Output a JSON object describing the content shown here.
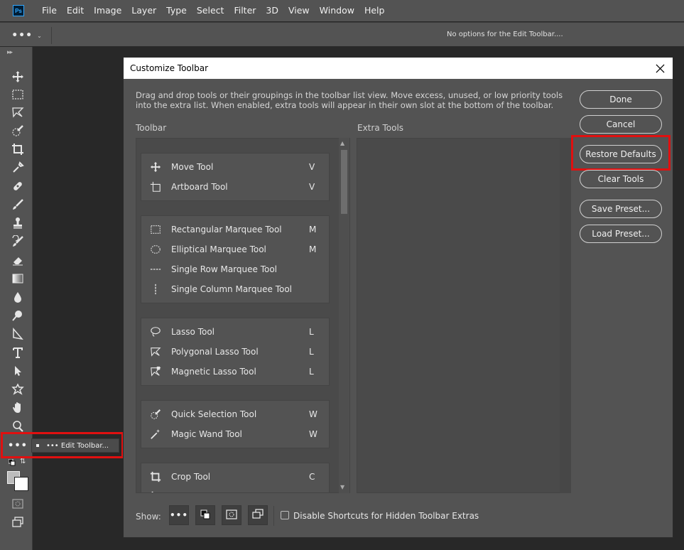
{
  "app": {
    "logo": "Ps"
  },
  "menubar": {
    "items": [
      "File",
      "Edit",
      "Image",
      "Layer",
      "Type",
      "Select",
      "Filter",
      "3D",
      "View",
      "Window",
      "Help"
    ]
  },
  "optionsbar": {
    "dots": "•••",
    "message": "No options for the Edit Toolbar...."
  },
  "toolbar": {
    "icons": [
      "move-icon",
      "rect-marquee-icon",
      "lasso-icon",
      "quick-select-icon",
      "crop-icon",
      "eyedropper-icon",
      "healing-icon",
      "brush-icon",
      "stamp-icon",
      "history-brush-icon",
      "eraser-icon",
      "gradient-icon",
      "blur-icon",
      "dodge-icon",
      "pen-icon",
      "type-icon",
      "path-select-icon",
      "shape-icon",
      "hand-icon",
      "zoom-icon"
    ],
    "more_dots": "•••",
    "edit_toolbar_label": "••• Edit Toolbar..."
  },
  "dialog": {
    "title": "Customize Toolbar",
    "description": "Drag and drop tools or their groupings in the toolbar list view. Move excess, unused, or low priority tools into the extra list. When enabled, extra tools will appear in their own slot at the bottom of the toolbar.",
    "toolbar_label": "Toolbar",
    "extra_label": "Extra Tools",
    "groups": [
      {
        "tools": [
          {
            "icon": "move-icon",
            "name": "Move Tool",
            "key": "V"
          },
          {
            "icon": "artboard-icon",
            "name": "Artboard Tool",
            "key": "V"
          }
        ]
      },
      {
        "tools": [
          {
            "icon": "rect-marquee-icon",
            "name": "Rectangular Marquee Tool",
            "key": "M"
          },
          {
            "icon": "ellipse-marquee-icon",
            "name": "Elliptical Marquee Tool",
            "key": "M"
          },
          {
            "icon": "row-marquee-icon",
            "name": "Single Row Marquee Tool",
            "key": ""
          },
          {
            "icon": "column-marquee-icon",
            "name": "Single Column Marquee Tool",
            "key": ""
          }
        ]
      },
      {
        "tools": [
          {
            "icon": "lasso-icon",
            "name": "Lasso Tool",
            "key": "L"
          },
          {
            "icon": "polygonal-lasso-icon",
            "name": "Polygonal Lasso Tool",
            "key": "L"
          },
          {
            "icon": "magnetic-lasso-icon",
            "name": "Magnetic Lasso Tool",
            "key": "L"
          }
        ]
      },
      {
        "tools": [
          {
            "icon": "quick-select-icon",
            "name": "Quick Selection Tool",
            "key": "W"
          },
          {
            "icon": "magic-wand-icon",
            "name": "Magic Wand Tool",
            "key": "W"
          }
        ]
      },
      {
        "tools": [
          {
            "icon": "crop-icon",
            "name": "Crop Tool",
            "key": "C"
          }
        ]
      }
    ],
    "buttons": {
      "done": "Done",
      "cancel": "Cancel",
      "restore": "Restore Defaults",
      "clear": "Clear Tools",
      "save": "Save Preset...",
      "load": "Load Preset..."
    },
    "show_label": "Show:",
    "show_options": [
      "dots-icon",
      "fg-bg-icon",
      "quick-mask-icon",
      "screen-mode-icon"
    ],
    "disable_shortcuts_label": "Disable Shortcuts for Hidden Toolbar Extras"
  }
}
